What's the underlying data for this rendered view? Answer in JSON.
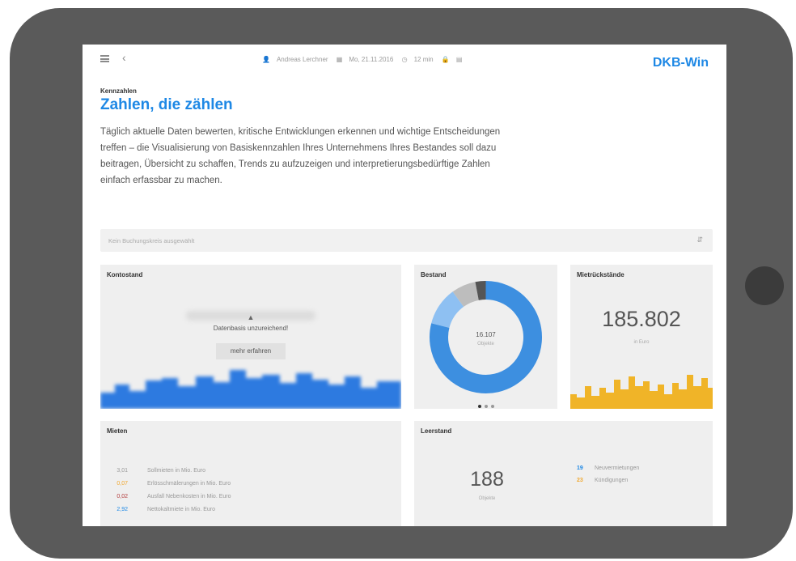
{
  "colors": {
    "accent": "#1e88e5",
    "donut_main": "#3d8fe0",
    "donut_light": "#8ec0f2",
    "donut_gray": "#bdbdbd",
    "donut_dark": "#555555",
    "konto_chart": "#2d7ae0",
    "miet_chart": "#f0b428",
    "mieten_blue": "#1e88e5",
    "mieten_orange": "#f0a830",
    "mieten_red": "#b33c3c",
    "leer_blue": "#1e88e5",
    "leer_orange": "#f0a830"
  },
  "topbar": {
    "menu_icon": "hamburger-icon",
    "back_icon": "chevron-left-icon",
    "user": "Andreas Lerchner",
    "date": "Mo, 21.11.2016",
    "duration": "12 min",
    "extra": "",
    "brand": "DKB-Win"
  },
  "header": {
    "kicker": "Kennzahlen",
    "title": "Zahlen, die zählen",
    "description": "Täglich aktuelle Daten bewerten, kritische Entwicklungen erkennen und wichtige Entscheidungen treffen – die Visualisierung von Basiskennzahlen Ihres Unternehmens Ihres Bestandes soll dazu beitragen, Übersicht zu schaffen, Trends zu aufzuzeigen und interpretierungsbedürftige Zahlen einfach erfassbar zu machen."
  },
  "filter": {
    "placeholder": "Kein Buchungskreis ausgewählt",
    "icon": "expand-icon"
  },
  "kontostand": {
    "title": "Kontostand",
    "warning": "Datenbasis unzureichend!",
    "button": "mehr erfahren"
  },
  "bestand": {
    "title": "Bestand",
    "value": "16.107",
    "unit": "Objekte",
    "segments": [
      0.79,
      0.11,
      0.07,
      0.03
    ]
  },
  "mietrueckstaende": {
    "title": "Mietrückstände",
    "value": "185.802",
    "unit": "in Euro"
  },
  "mieten": {
    "title": "Mieten",
    "rows": [
      {
        "value": "3,01",
        "label": "Sollmieten in Mio. Euro",
        "color": "#9a9a9a"
      },
      {
        "value": "0,07",
        "label": "Erlösschmälerungen in Mio. Euro",
        "color": "#f0a830"
      },
      {
        "value": "0,02",
        "label": "Ausfall Nebenkosten in Mio. Euro",
        "color": "#b33c3c"
      },
      {
        "value": "2,92",
        "label": "Nettokaltmiete in Mio. Euro",
        "color": "#1e88e5"
      }
    ]
  },
  "leerstand": {
    "title": "Leerstand",
    "value": "188",
    "unit": "Objekte",
    "rows": [
      {
        "value": "19",
        "label": "Neuvermietungen",
        "color": "#1e88e5"
      },
      {
        "value": "23",
        "label": "Kündigungen",
        "color": "#f0a830"
      }
    ]
  }
}
